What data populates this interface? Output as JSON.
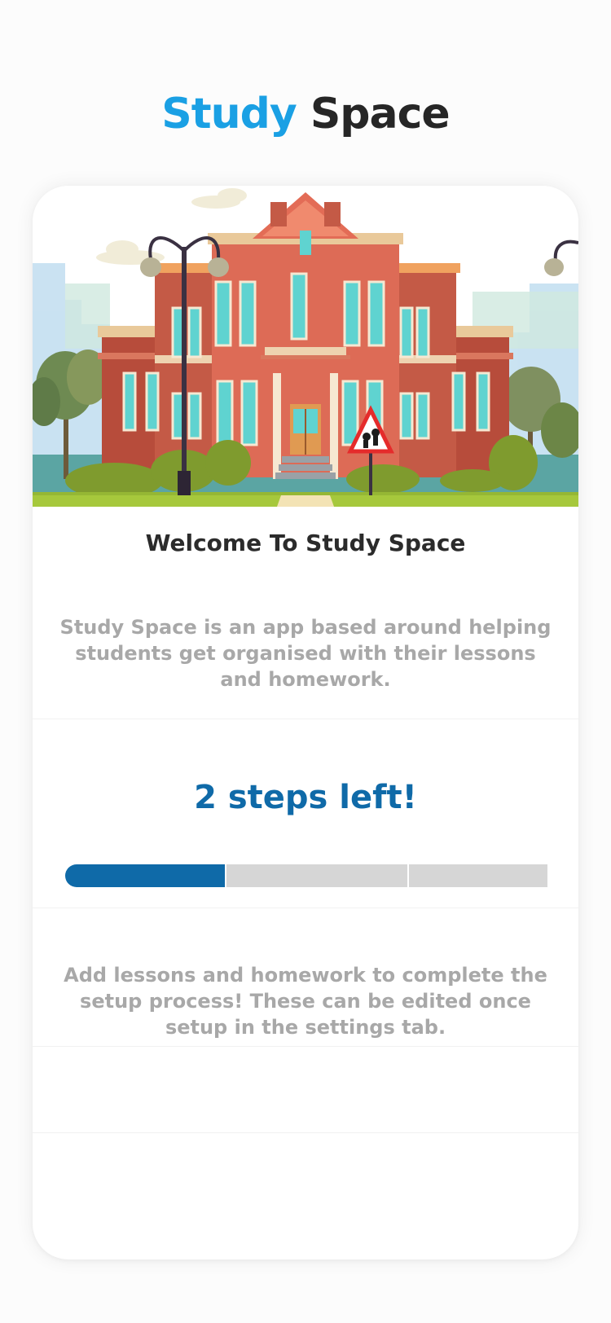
{
  "header": {
    "title_part1": "Study",
    "title_part2": "Space",
    "title_part1_color": "#1aa0e4",
    "title_part2_color": "#262626"
  },
  "hero": {
    "image": "school-building-illustration"
  },
  "welcome": {
    "heading": "Welcome To Study Space",
    "description": "Study Space is an app based around helping students get organised with their lessons and homework."
  },
  "setup": {
    "steps_left_label": "2 steps left!",
    "total_steps": 3,
    "completed_steps": 1,
    "accent_color": "#0f6aa8",
    "instructions": "Add lessons and homework to complete the setup process! These can be edited once setup in the settings tab."
  }
}
